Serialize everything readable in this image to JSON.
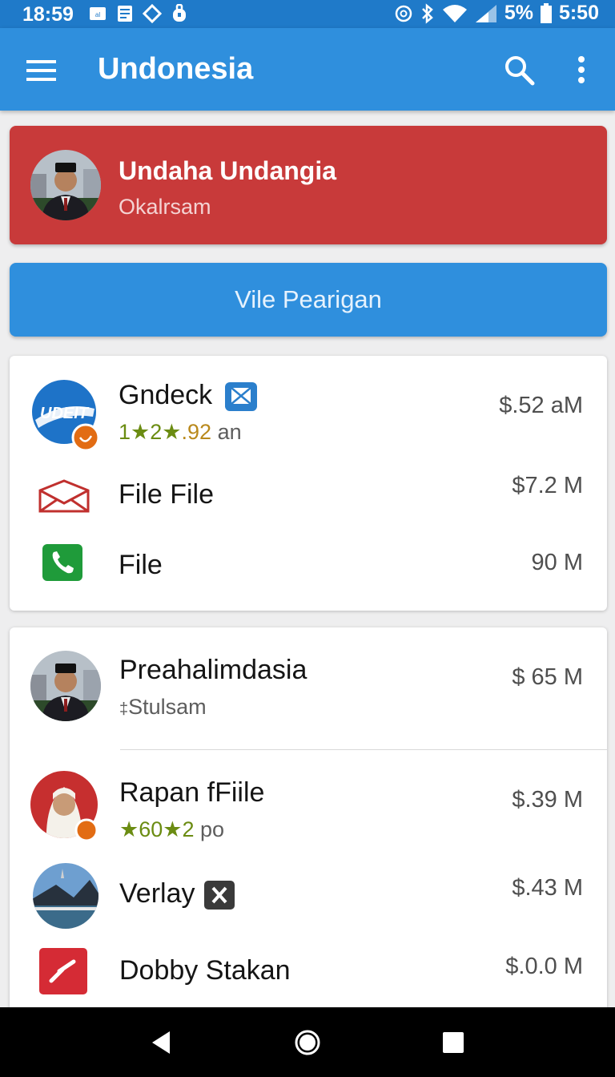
{
  "status_bar": {
    "time": "18:59",
    "battery": "5%",
    "clock": "5:50"
  },
  "app_bar": {
    "title": "Undonesia",
    "menu_icon": "hamburger-icon",
    "search_icon": "search-icon",
    "more_icon": "more-vert-icon"
  },
  "promo": {
    "title": "Undaha Undangia",
    "subtitle": "Okalrsam"
  },
  "primary_button": {
    "label": "Vile Pearigan"
  },
  "card1": {
    "items": [
      {
        "title": "Gndeck",
        "logo_text": "UDEIT",
        "rating_a": "1",
        "rating_b": "2",
        "rating_c": ".92",
        "rating_suffix": "an",
        "value": "$.52 aM"
      },
      {
        "title": "File File",
        "value": "$7.2 M"
      },
      {
        "title": "File",
        "value": "90 M"
      }
    ]
  },
  "card2": {
    "items": [
      {
        "title": "Preahalimdasia",
        "subtitle_mark": "‡",
        "subtitle": "Stulsam",
        "value": "$ 65  M"
      },
      {
        "title": "Rapan fFiile",
        "rating_a": "60",
        "rating_b": "2",
        "rating_suffix": "po",
        "value": "$.39  M"
      },
      {
        "title": "Verlay",
        "value": "$.43  M"
      },
      {
        "title": "Dobby Stakan",
        "value": "$.0.0 M"
      }
    ]
  },
  "colors": {
    "app_bar": "#2f8fdd",
    "status_bar": "#1f7ac9",
    "promo": "#c83a3a",
    "rating_green": "#6b8c12"
  }
}
